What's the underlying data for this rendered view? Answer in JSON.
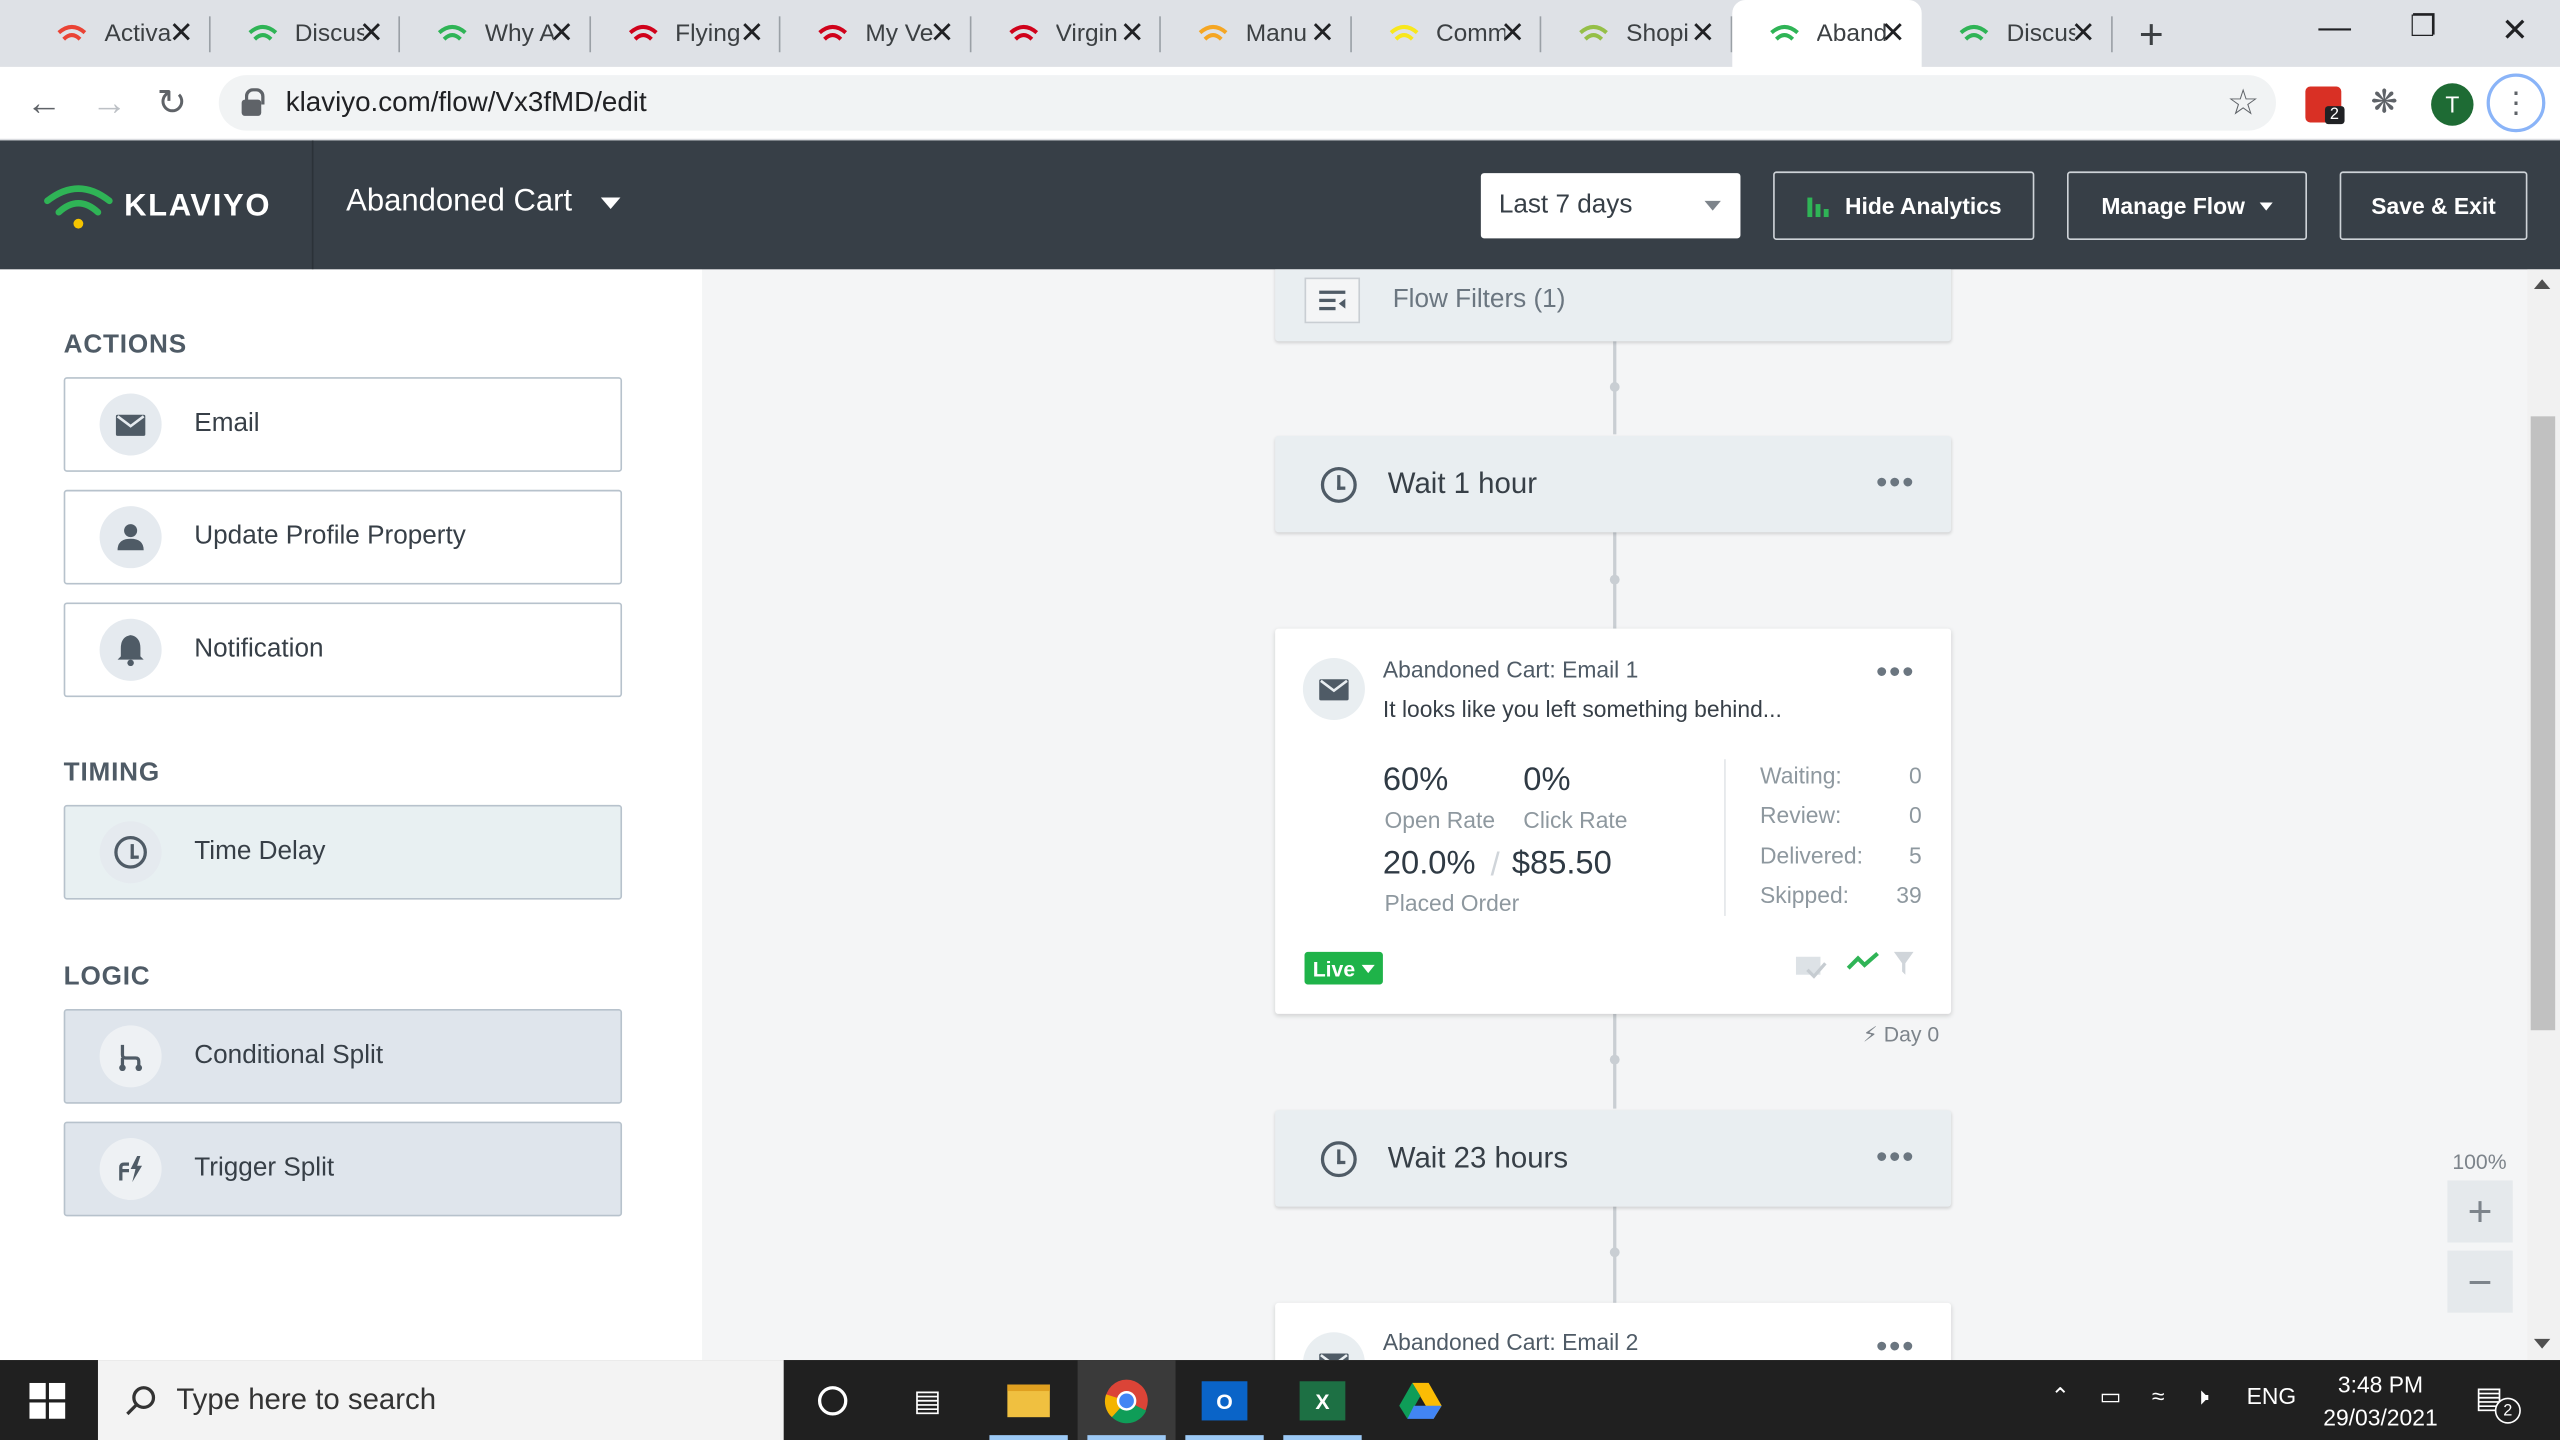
{
  "browser": {
    "tabs": [
      {
        "title": "Activa",
        "icon": "gmail-icon",
        "color": "#ea4335",
        "active": false
      },
      {
        "title": "Discus",
        "icon": "klaviyo-icon",
        "color": "#2fb456",
        "active": false
      },
      {
        "title": "Why A",
        "icon": "klaviyo-icon",
        "color": "#2fb456",
        "active": false
      },
      {
        "title": "Flying",
        "icon": "virgin-icon",
        "color": "#d0021b",
        "active": false
      },
      {
        "title": "My Ve",
        "icon": "virgin-v-icon",
        "color": "#d0021b",
        "active": false
      },
      {
        "title": "Virgin",
        "icon": "virgin-icon",
        "color": "#d0021b",
        "active": false
      },
      {
        "title": "Manu",
        "icon": "manual-icon",
        "color": "#f5a623",
        "active": false
      },
      {
        "title": "Comm",
        "icon": "diamond-icon",
        "color": "#f8e71c",
        "active": false
      },
      {
        "title": "Shopi",
        "icon": "shopify-icon",
        "color": "#95bf47",
        "active": false
      },
      {
        "title": "Aband",
        "icon": "klaviyo-icon",
        "color": "#2fb456",
        "active": true
      },
      {
        "title": "Discus",
        "icon": "klaviyo-icon",
        "color": "#2fb456",
        "active": false
      }
    ],
    "url": "klaviyo.com/flow/Vx3fMD/edit",
    "profile_initial": "T",
    "extension_badge": "2"
  },
  "header": {
    "logo_text": "KLAVIYO",
    "flow_name": "Abandoned Cart",
    "date_range": "Last 7 days",
    "hide_analytics": "Hide Analytics",
    "manage_flow": "Manage Flow",
    "save_exit": "Save & Exit"
  },
  "sidebar": {
    "actions_title": "ACTIONS",
    "actions": [
      {
        "label": "Email",
        "icon": "envelope-icon"
      },
      {
        "label": "Update Profile Property",
        "icon": "person-icon"
      },
      {
        "label": "Notification",
        "icon": "bell-icon"
      }
    ],
    "timing_title": "TIMING",
    "timing": [
      {
        "label": "Time Delay",
        "icon": "clock-icon"
      }
    ],
    "logic_title": "LOGIC",
    "logic": [
      {
        "label": "Conditional Split",
        "icon": "split-icon"
      },
      {
        "label": "Trigger Split",
        "icon": "trigger-split-icon"
      }
    ]
  },
  "canvas": {
    "flow_filters": "Flow Filters (1)",
    "wait1": "Wait 1 hour",
    "email1": {
      "name": "Abandoned Cart: Email 1",
      "subject": "It looks like you left something behind...",
      "open_rate": "60%",
      "open_rate_label": "Open Rate",
      "click_rate": "0%",
      "click_rate_label": "Click Rate",
      "placed_order_pct": "20.0%",
      "placed_order_value": "$85.50",
      "placed_order_label": "Placed Order",
      "waiting_label": "Waiting:",
      "waiting": "0",
      "review_label": "Review:",
      "review": "0",
      "delivered_label": "Delivered:",
      "delivered": "5",
      "skipped_label": "Skipped:",
      "skipped": "39",
      "status": "Live",
      "day": "Day 0"
    },
    "wait2": "Wait 23 hours",
    "email2_name": "Abandoned Cart: Email 2",
    "zoom": "100%"
  },
  "taskbar": {
    "search_placeholder": "Type here to search",
    "language": "ENG",
    "time": "3:48 PM",
    "date": "29/03/2021",
    "notification_count": "2"
  },
  "colors": {
    "header_bg": "#373f47",
    "accent_green": "#2fb456",
    "live_green": "#1fb349"
  }
}
